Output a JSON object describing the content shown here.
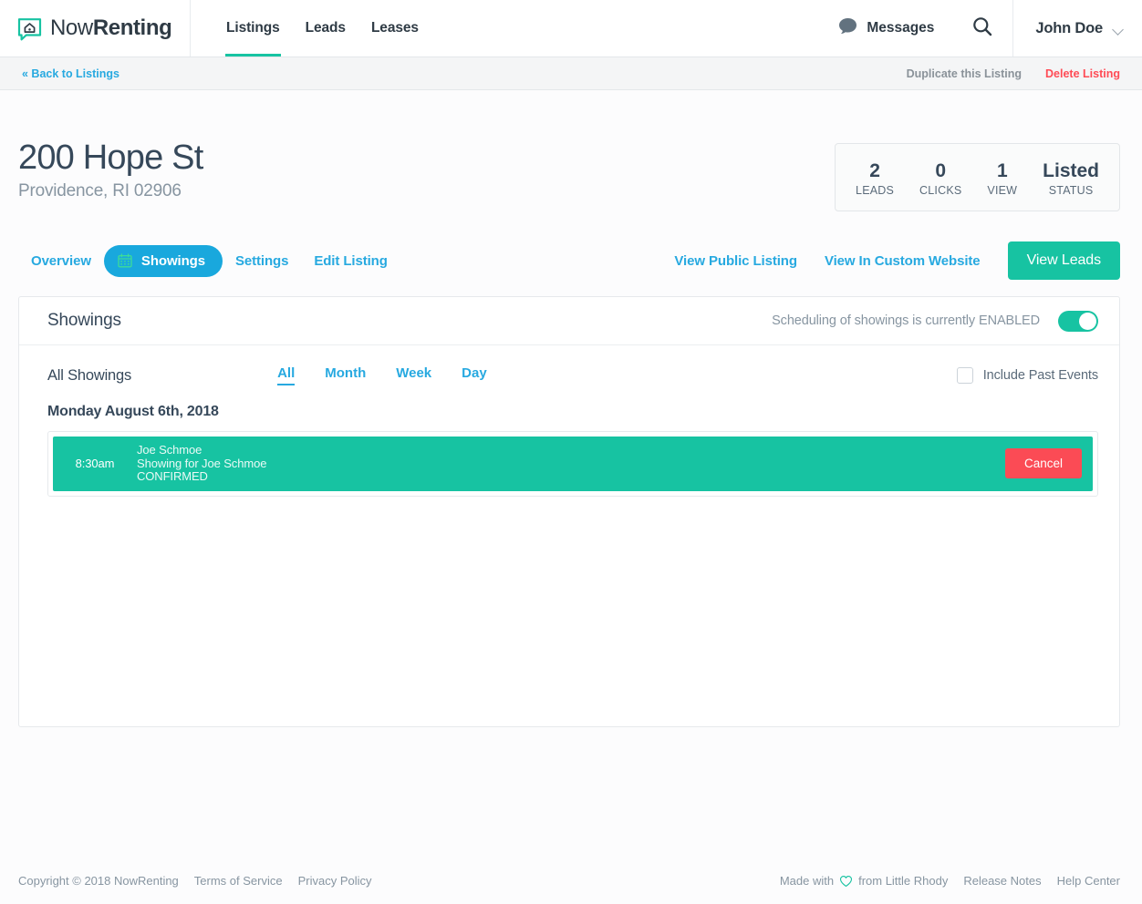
{
  "brand": {
    "name_light": "Now",
    "name_bold": "Renting",
    "icon": "house-chat-logo"
  },
  "topnav": {
    "items": [
      {
        "label": "Listings",
        "active": true
      },
      {
        "label": "Leads",
        "active": false
      },
      {
        "label": "Leases",
        "active": false
      }
    ],
    "messages_label": "Messages",
    "search_icon": "search-icon",
    "user_name": "John Doe"
  },
  "subbar": {
    "back_label": "« Back to Listings",
    "duplicate_label": "Duplicate this Listing",
    "delete_label": "Delete Listing"
  },
  "listing": {
    "title": "200 Hope St",
    "subtitle": "Providence, RI 02906",
    "stats": [
      {
        "value": "2",
        "label": "LEADS"
      },
      {
        "value": "0",
        "label": "CLICKS"
      },
      {
        "value": "1",
        "label": "VIEW"
      },
      {
        "value": "Listed",
        "label": "STATUS"
      }
    ]
  },
  "tabs": {
    "items": [
      {
        "label": "Overview",
        "active": false
      },
      {
        "label": "Showings",
        "active": true,
        "icon": "calendar-icon"
      },
      {
        "label": "Settings",
        "active": false
      },
      {
        "label": "Edit Listing",
        "active": false
      }
    ],
    "view_public_label": "View Public Listing",
    "view_custom_label": "View In Custom Website",
    "view_leads_label": "View Leads"
  },
  "panel": {
    "title": "Showings",
    "toggle_label": "Scheduling of showings is currently ENABLED",
    "toggle_on": true,
    "filter_title": "All Showings",
    "range_tabs": [
      {
        "label": "All",
        "active": true
      },
      {
        "label": "Month",
        "active": false
      },
      {
        "label": "Week",
        "active": false
      },
      {
        "label": "Day",
        "active": false
      }
    ],
    "include_past_label": "Include Past Events",
    "include_past_checked": false,
    "day_header": "Monday August 6th, 2018",
    "event": {
      "time": "8:30am",
      "name": "Joe Schmoe",
      "description": "Showing for Joe Schmoe",
      "status": "CONFIRMED",
      "cancel_label": "Cancel"
    }
  },
  "footer": {
    "copyright": "Copyright © 2018 NowRenting",
    "terms": "Terms of Service",
    "privacy": "Privacy Policy",
    "made_with": "Made with",
    "from_text": "from Little Rhody",
    "release_notes": "Release Notes",
    "help_center": "Help Center"
  },
  "colors": {
    "teal": "#17c3a2",
    "blue": "#27a9e0",
    "red": "#ff4b55",
    "slate": "#36485a"
  }
}
